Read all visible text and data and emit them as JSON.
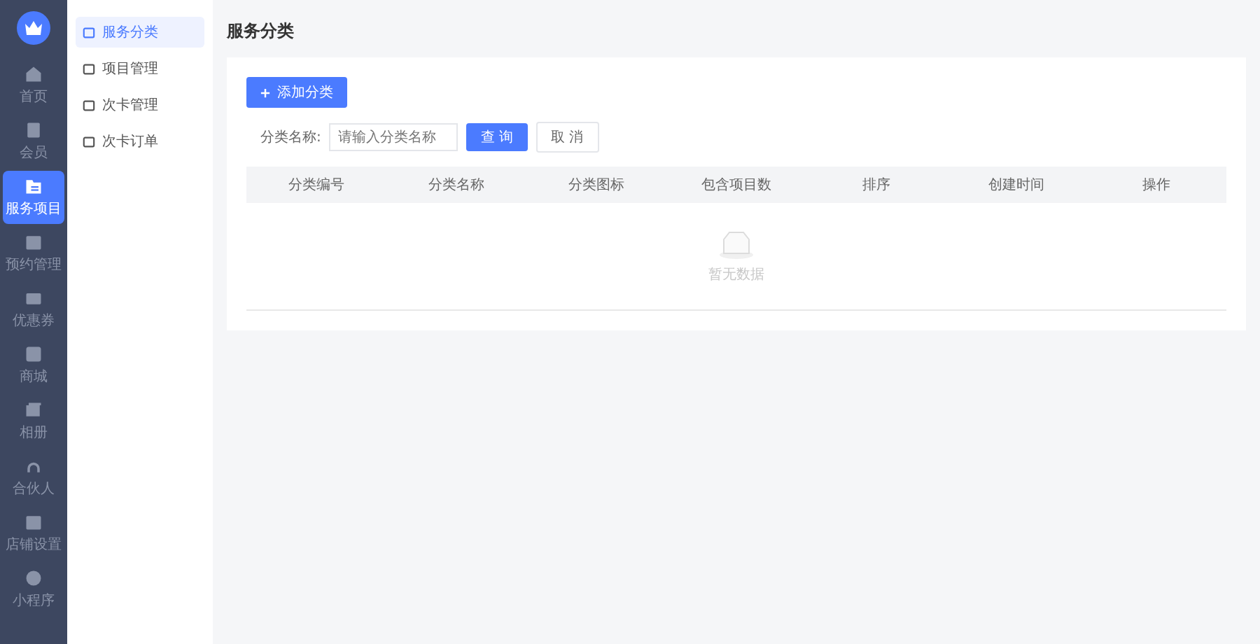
{
  "sidebar": {
    "items": [
      {
        "label": "首页",
        "selected": false
      },
      {
        "label": "会员",
        "selected": false
      },
      {
        "label": "服务项目",
        "selected": true
      },
      {
        "label": "预约管理",
        "selected": false
      },
      {
        "label": "优惠券",
        "selected": false
      },
      {
        "label": "商城",
        "selected": false
      },
      {
        "label": "相册",
        "selected": false
      },
      {
        "label": "合伙人",
        "selected": false
      },
      {
        "label": "店铺设置",
        "selected": false
      },
      {
        "label": "小程序",
        "selected": false
      }
    ]
  },
  "submenu": {
    "items": [
      {
        "label": "服务分类",
        "selected": true
      },
      {
        "label": "项目管理",
        "selected": false
      },
      {
        "label": "次卡管理",
        "selected": false
      },
      {
        "label": "次卡订单",
        "selected": false
      }
    ]
  },
  "page_title": "服务分类",
  "add_button": "添加分类",
  "filter": {
    "label": "分类名称:",
    "placeholder": "请输入分类名称",
    "search_button": "查 询",
    "cancel_button": "取 消"
  },
  "table": {
    "columns": [
      "分类编号",
      "分类名称",
      "分类图标",
      "包含项目数",
      "排序",
      "创建时间",
      "操作"
    ],
    "empty_text": "暂无数据"
  }
}
